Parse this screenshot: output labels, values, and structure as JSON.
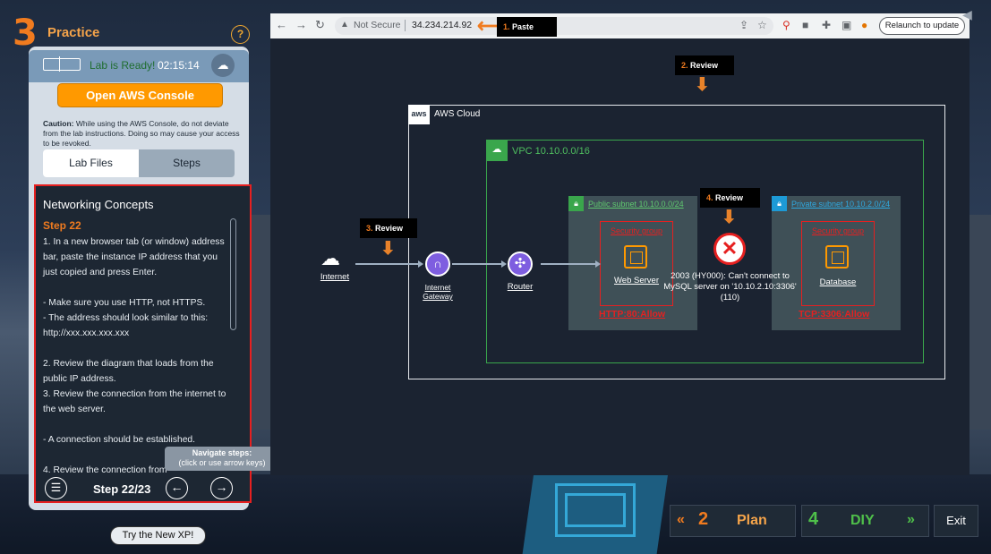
{
  "brand": {
    "number": "3",
    "title": "Practice",
    "help": "?"
  },
  "lab": {
    "status": "Lab is Ready!",
    "timer": "02:15:14",
    "console_button": "Open AWS Console"
  },
  "caution": {
    "label": "Caution:",
    "text": " While using the AWS Console, do not deviate from the lab instructions. Doing so may cause your access to be revoked."
  },
  "tabs": [
    {
      "label": "Lab Files"
    },
    {
      "label": "Steps"
    }
  ],
  "steps": {
    "heading": "Networking Concepts",
    "step_title": "Step 22",
    "body": "1. In a new browser tab (or window) address bar, paste the instance IP address that you just copied and press Enter.\n\n- Make sure you use HTTP, not HTTPS.\n- The address should look similar to this: http://xxx.xxx.xxx.xxx\n\n2. Review the diagram that loads from the public IP address.\n3. Review the connection from the internet to the web server.\n\n- A connection should be established.\n\n4. Review the connection from",
    "counter": "Step 22/23",
    "tooltip_title": "Navigate steps:",
    "tooltip_sub": "(click or use arrow keys)"
  },
  "try_button": "Try the New XP!",
  "browser": {
    "not_secure": "Not Secure",
    "url": "34.234.214.92",
    "relaunch": "Relaunch to update"
  },
  "callouts": [
    {
      "num": "1.",
      "text": "Paste"
    },
    {
      "num": "2.",
      "text": "Review"
    },
    {
      "num": "3.",
      "text": "Review"
    },
    {
      "num": "4.",
      "text": "Review"
    }
  ],
  "diagram": {
    "aws_logo": "aws",
    "aws_cloud": "AWS Cloud",
    "vpc": "VPC 10.10.0.0/16",
    "public_subnet": "Public subnet 10.10.0.0/24",
    "private_subnet": "Private subnet 10.10.2.0/24",
    "security_group": "Security group",
    "internet": "Internet",
    "igw": "Internet Gateway",
    "router": "Router",
    "web_server": "Web Server",
    "database": "Database",
    "http_allow": "HTTP:80:Allow",
    "tcp_allow": "TCP:3306:Allow",
    "error": "2003 (HY000): Can't connect to MySQL server on '10.10.2.10:3306' (110)"
  },
  "bottom_nav": {
    "plan_num": "2",
    "plan_label": "Plan",
    "diy_num": "4",
    "diy_label": "DIY",
    "exit": "Exit"
  },
  "colors": {
    "accent": "#f07b1f",
    "aws_orange": "#ff9900",
    "error_red": "#e62020",
    "vpc_green": "#3aa64c",
    "diy_green": "#4fc04a"
  }
}
